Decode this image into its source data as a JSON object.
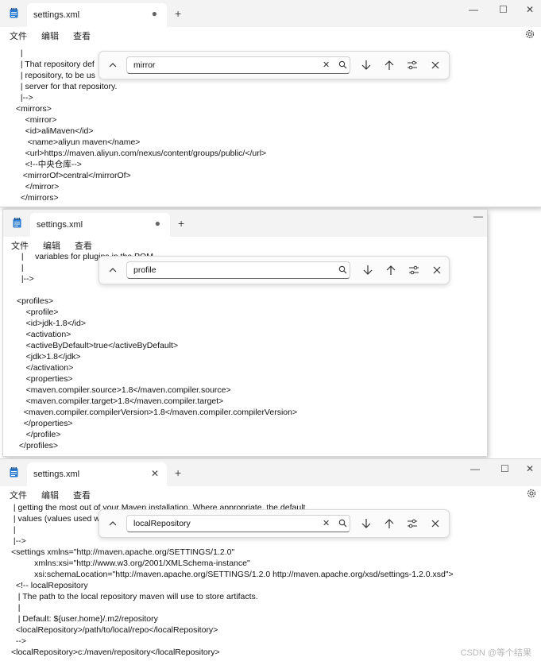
{
  "menu": {
    "file": "文件",
    "edit": "编辑",
    "view": "查看"
  },
  "window1": {
    "tab_title": "settings.xml",
    "find_query": "mirror",
    "lines": [
      "  |",
      "  | That repository def",
      "  | repository, to be us",
      "  | server for that repository.",
      "  |-->",
      "<mirrors>",
      "    <mirror>",
      "    <id>aliMaven</id>",
      "     <name>aliyun maven</name>",
      "    <url>https://maven.aliyun.com/nexus/content/groups/public/</url>",
      "    <!--中央仓库-->",
      "   <mirrorOf>central</mirrorOf>",
      "    </mirror>",
      "  </mirrors>"
    ]
  },
  "window2": {
    "tab_title": "settings.xml",
    "find_query": "profile",
    "lines": [
      "  |     variables for plugins in the POM.",
      "  |",
      "  |-->",
      "",
      "<profiles>",
      "    <profile>",
      "    <id>jdk-1.8</id>",
      "    <activation>",
      "    <activeByDefault>true</activeByDefault>",
      "    <jdk>1.8</jdk>",
      "    </activation>",
      "    <properties>",
      "    <maven.compiler.source>1.8</maven.compiler.source>",
      "    <maven.compiler.target>1.8</maven.compiler.target>",
      "   <maven.compiler.compilerVersion>1.8</maven.compiler.compilerVersion>",
      "   </properties>",
      "    </profile>",
      " </profiles>"
    ]
  },
  "window3": {
    "tab_title": "settings.xml",
    "find_query": "localRepository",
    "lines": [
      " | getting the most out of your Maven installation. Where appropriate, the default",
      " | values (values used w",
      " |",
      " |-->",
      "<settings xmlns=\"http://maven.apache.org/SETTINGS/1.2.0\"",
      "          xmlns:xsi=\"http://www.w3.org/2001/XMLSchema-instance\"",
      "          xsi:schemaLocation=\"http://maven.apache.org/SETTINGS/1.2.0 http://maven.apache.org/xsd/settings-1.2.0.xsd\">",
      "  <!-- localRepository",
      "   | The path to the local repository maven will use to store artifacts.",
      "   |",
      "   | Default: ${user.home}/.m2/repository",
      "  <localRepository>/path/to/local/repo</localRepository>",
      "  -->",
      "<localRepository>c:/maven/repository</localRepository>"
    ]
  },
  "watermark": "CSDN @等个结果"
}
